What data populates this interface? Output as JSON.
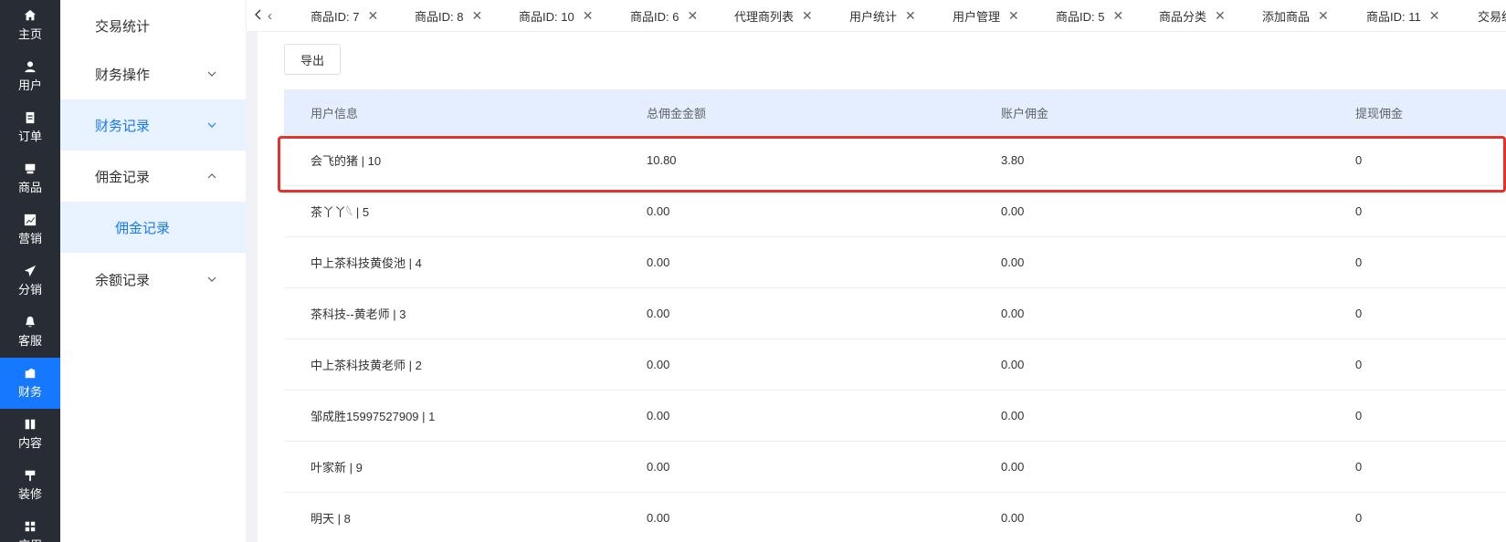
{
  "nav": {
    "items": [
      {
        "label": "主页",
        "icon": "home-icon"
      },
      {
        "label": "用户",
        "icon": "user-icon"
      },
      {
        "label": "订单",
        "icon": "order-icon"
      },
      {
        "label": "商品",
        "icon": "product-icon"
      },
      {
        "label": "营销",
        "icon": "marketing-icon"
      },
      {
        "label": "分销",
        "icon": "send-icon"
      },
      {
        "label": "客服",
        "icon": "bell-icon"
      },
      {
        "label": "财务",
        "icon": "wallet-icon",
        "active": true
      },
      {
        "label": "内容",
        "icon": "book-icon"
      },
      {
        "label": "装修",
        "icon": "brush-icon"
      },
      {
        "label": "应用",
        "icon": "grid-icon"
      }
    ]
  },
  "submenu": {
    "items": [
      {
        "label": "交易统计"
      },
      {
        "label": "财务操作"
      },
      {
        "label": "财务记录"
      },
      {
        "label": "佣金记录"
      },
      {
        "label": "佣金记录"
      },
      {
        "label": "余额记录"
      }
    ]
  },
  "tabs": {
    "prev_label": "‹",
    "items": [
      {
        "label": "商品ID: 7"
      },
      {
        "label": "商品ID: 8"
      },
      {
        "label": "商品ID: 10"
      },
      {
        "label": "商品ID: 6"
      },
      {
        "label": "代理商列表"
      },
      {
        "label": "用户统计"
      },
      {
        "label": "用户管理"
      },
      {
        "label": "商品ID: 5"
      },
      {
        "label": "商品分类"
      },
      {
        "label": "添加商品"
      },
      {
        "label": "商品ID: 11"
      },
      {
        "label": "交易统计"
      }
    ]
  },
  "toolbar": {
    "export_label": "导出"
  },
  "table": {
    "headers": [
      "用户信息",
      "总佣金金额",
      "账户佣金",
      "提现佣金"
    ],
    "rows": [
      [
        "会飞的猪 | 10",
        "10.80",
        "3.80",
        "0"
      ],
      [
        "茶丫丫𓆩 | 5",
        "0.00",
        "0.00",
        "0"
      ],
      [
        "中上茶科技黄俊池 | 4",
        "0.00",
        "0.00",
        "0"
      ],
      [
        "茶科技--黄老师 | 3",
        "0.00",
        "0.00",
        "0"
      ],
      [
        "中上茶科技黄老师 | 2",
        "0.00",
        "0.00",
        "0"
      ],
      [
        "邹成胜15997527909 | 1",
        "0.00",
        "0.00",
        "0"
      ],
      [
        "叶家新 | 9",
        "0.00",
        "0.00",
        "0"
      ],
      [
        "明天 | 8",
        "0.00",
        "0.00",
        "0"
      ]
    ]
  },
  "colors": {
    "rail_bg": "#282c34",
    "accent": "#1677ff",
    "highlight_border": "#e5322d",
    "table_head_bg": "#e4eeff"
  }
}
